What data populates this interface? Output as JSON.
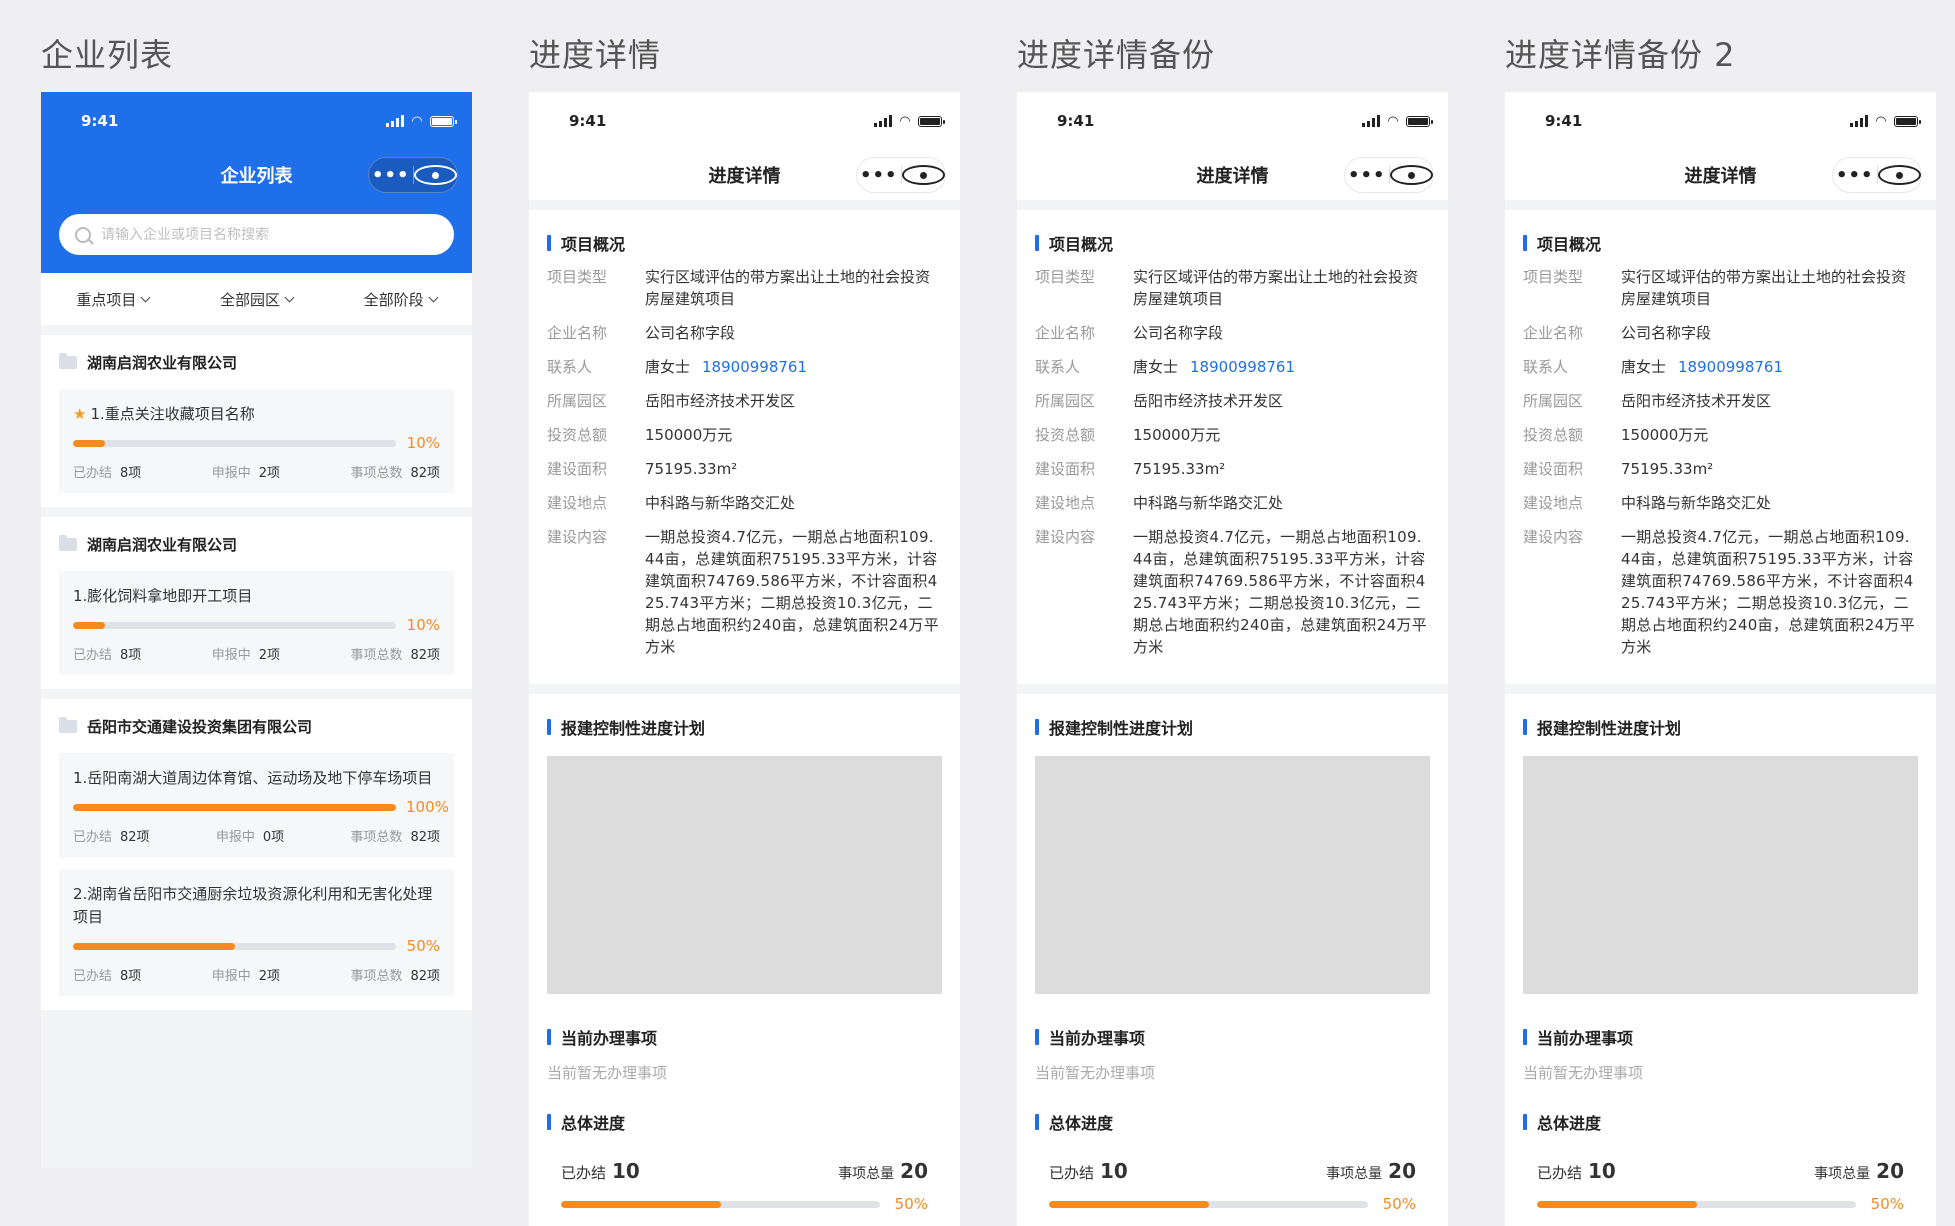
{
  "titles": [
    "企业列表",
    "进度详情",
    "进度详情备份",
    "进度详情备份 2"
  ],
  "status_time": "9:41",
  "capsule": {
    "more": "•••"
  },
  "list": {
    "nav_title": "企业列表",
    "search_placeholder": "请输入企业或项目名称搜索",
    "filters": [
      "重点项目",
      "全部园区",
      "全部阶段"
    ],
    "stat_labels": {
      "done": "已办结",
      "reporting": "申报中",
      "total": "事项总数"
    },
    "companies": [
      {
        "name": "湖南启润农业有限公司",
        "projects": [
          {
            "name": "1.重点关注收藏项目名称",
            "starred": true,
            "percent": 10,
            "percent_label": "10%",
            "done": "8项",
            "reporting": "2项",
            "total": "82项"
          }
        ]
      },
      {
        "name": "湖南启润农业有限公司",
        "projects": [
          {
            "name": "1.膨化饲料拿地即开工项目",
            "starred": false,
            "percent": 10,
            "percent_label": "10%",
            "done": "8项",
            "reporting": "2项",
            "total": "82项"
          }
        ]
      },
      {
        "name": "岳阳市交通建设投资集团有限公司",
        "projects": [
          {
            "name": "1.岳阳南湖大道周边体育馆、运动场及地下停车场项目",
            "starred": false,
            "percent": 100,
            "percent_label": "100%",
            "done": "82项",
            "reporting": "0项",
            "total": "82项"
          },
          {
            "name": "2.湖南省岳阳市交通厨余垃圾资源化利用和无害化处理项目",
            "starred": false,
            "percent": 50,
            "percent_label": "50%",
            "done": "8项",
            "reporting": "2项",
            "total": "82项"
          }
        ]
      }
    ]
  },
  "detail": {
    "nav_title": "进度详情",
    "overview_title": "项目概况",
    "fields": [
      {
        "key": "项目类型",
        "value": "实行区域评估的带方案出让土地的社会投资房屋建筑项目"
      },
      {
        "key": "企业名称",
        "value": "公司名称字段"
      },
      {
        "key": "联系人",
        "value": "唐女士",
        "phone": "18900998761"
      },
      {
        "key": "所属园区",
        "value": "岳阳市经济技术开发区"
      },
      {
        "key": "投资总额",
        "value": "150000万元"
      },
      {
        "key": "建设面积",
        "value": "75195.33m²"
      },
      {
        "key": "建设地点",
        "value": "中科路与新华路交汇处"
      },
      {
        "key": "建设内容",
        "value": "一期总投资4.7亿元，一期总占地面积109.44亩，总建筑面积75195.33平方米，计容建筑面积74769.586平方米，不计容面积425.743平方米；二期总投资10.3亿元，二期总占地面积约240亩，总建筑面积24万平方米"
      }
    ],
    "plan_title": "报建控制性进度计划",
    "current_title": "当前办理事项",
    "current_empty": "当前暂无办理事项",
    "total_title": "总体进度",
    "done_label": "已办结",
    "done_value": "10",
    "total_label": "事项总量",
    "total_value": "20",
    "percent": 50,
    "percent_label": "50%"
  },
  "colors": {
    "brand": "#1f6fea",
    "progress": "#f58a1f",
    "track": "#dfe2e6"
  }
}
